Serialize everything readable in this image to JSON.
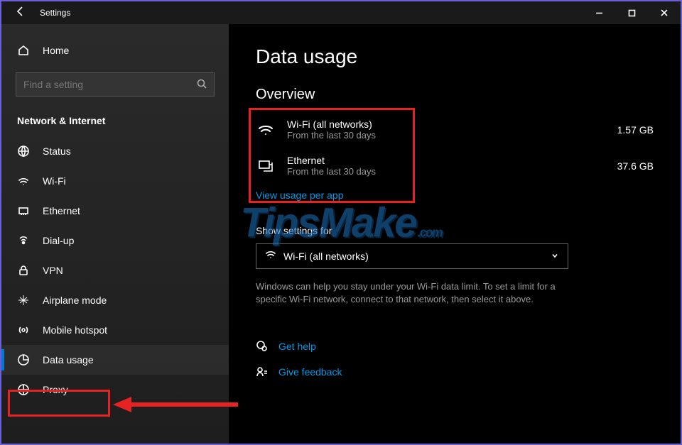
{
  "titlebar": {
    "title": "Settings"
  },
  "sidebar": {
    "home": "Home",
    "search_placeholder": "Find a setting",
    "section": "Network & Internet",
    "items": [
      {
        "label": "Status"
      },
      {
        "label": "Wi-Fi"
      },
      {
        "label": "Ethernet"
      },
      {
        "label": "Dial-up"
      },
      {
        "label": "VPN"
      },
      {
        "label": "Airplane mode"
      },
      {
        "label": "Mobile hotspot"
      },
      {
        "label": "Data usage"
      },
      {
        "label": "Proxy"
      }
    ]
  },
  "main": {
    "title": "Data usage",
    "overview_header": "Overview",
    "usage": [
      {
        "name": "Wi-Fi (all networks)",
        "sub": "From the last 30 days",
        "amount": "1.57 GB"
      },
      {
        "name": "Ethernet",
        "sub": "From the last 30 days",
        "amount": "37.6 GB"
      }
    ],
    "view_link": "View usage per app",
    "dd_label": "Show settings for",
    "dd_value": "Wi-Fi (all networks)",
    "help_text": "Windows can help you stay under your Wi-Fi data limit. To set a limit for a specific Wi-Fi network, connect to that network, then select it above.",
    "get_help": "Get help",
    "feedback": "Give feedback"
  },
  "watermark": {
    "text": "TipsMake",
    "suffix": ".com"
  }
}
